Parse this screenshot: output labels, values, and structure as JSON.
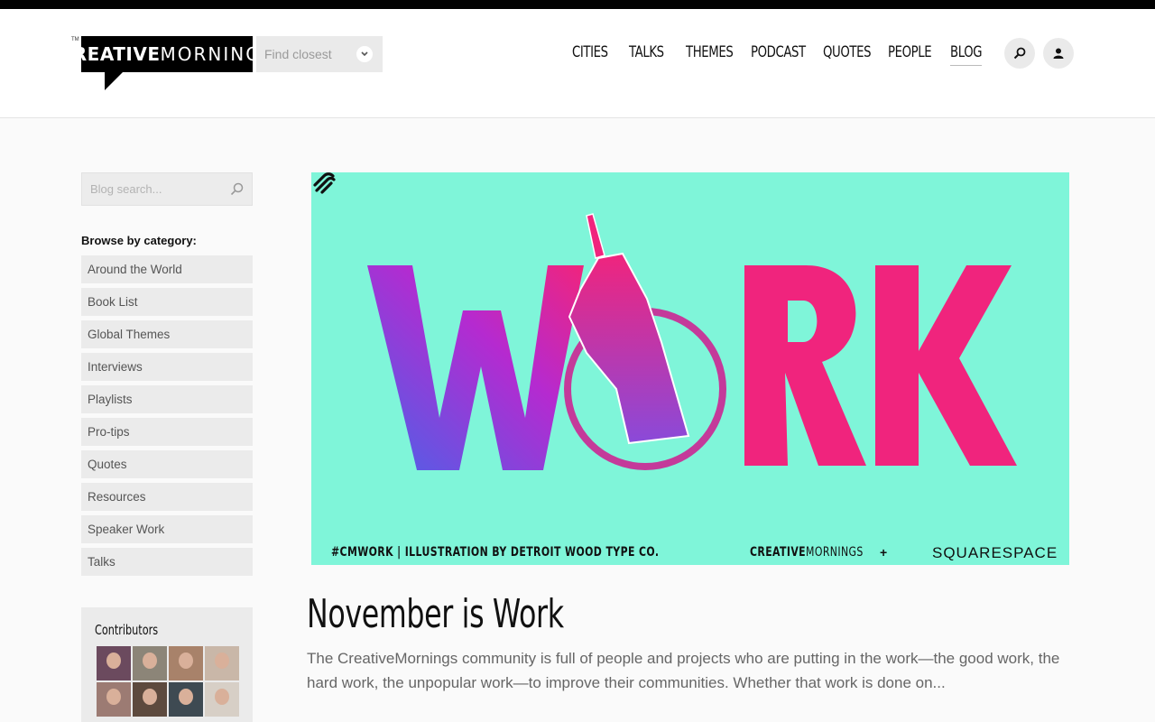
{
  "header": {
    "trademark": "TM",
    "logo_bold": "CREATIVE",
    "logo_light": "MORNINGS",
    "city_select_placeholder": "Find closest",
    "nav": [
      "CITIES",
      "TALKS",
      "THEMES",
      "PODCAST",
      "QUOTES",
      "PEOPLE",
      "BLOG"
    ],
    "active_nav": "BLOG",
    "search_icon": "search-icon",
    "account_icon": "user-icon"
  },
  "sidebar": {
    "search_placeholder": "Blog search...",
    "browse_title": "Browse by category:",
    "categories": [
      "Around the World",
      "Book List",
      "Global Themes",
      "Interviews",
      "Playlists",
      "Pro-tips",
      "Quotes",
      "Resources",
      "Speaker Work",
      "Talks"
    ],
    "contributors_title": "Contributors"
  },
  "post": {
    "hero_word": "WORK",
    "hero_caption": "#CMWORK  |  ILLUSTRATION BY DETROIT WOOD TYPE CO.",
    "hero_brand_bold": "CREATIVE",
    "hero_brand_light": "MORNINGS",
    "hero_plus": "+",
    "hero_partner": "SQUARESPACE",
    "title": "November is Work",
    "excerpt": "The CreativeMornings community is full of people and projects who are putting in the work—the good work, the hard work, the unpopular work—to improve their communities. Whether that work is done on..."
  },
  "colors": {
    "hero_bg": "#7ff5d9",
    "hero_pink": "#f0247d",
    "hero_blue": "#4a63e8"
  }
}
